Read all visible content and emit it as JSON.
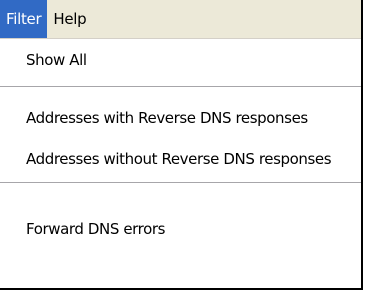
{
  "menubar": {
    "items": [
      {
        "label": "Filter",
        "active": true
      },
      {
        "label": "Help",
        "active": false
      }
    ]
  },
  "filter_menu": {
    "items": [
      {
        "label": "Show All"
      },
      {
        "label": "Addresses with Reverse DNS responses"
      },
      {
        "label": "Addresses without Reverse DNS responses"
      },
      {
        "label": "Forward DNS errors"
      }
    ]
  },
  "colors": {
    "menubar_bg": "#ece9d8",
    "highlight": "#316ac5",
    "separator": "#a7a6aa"
  }
}
